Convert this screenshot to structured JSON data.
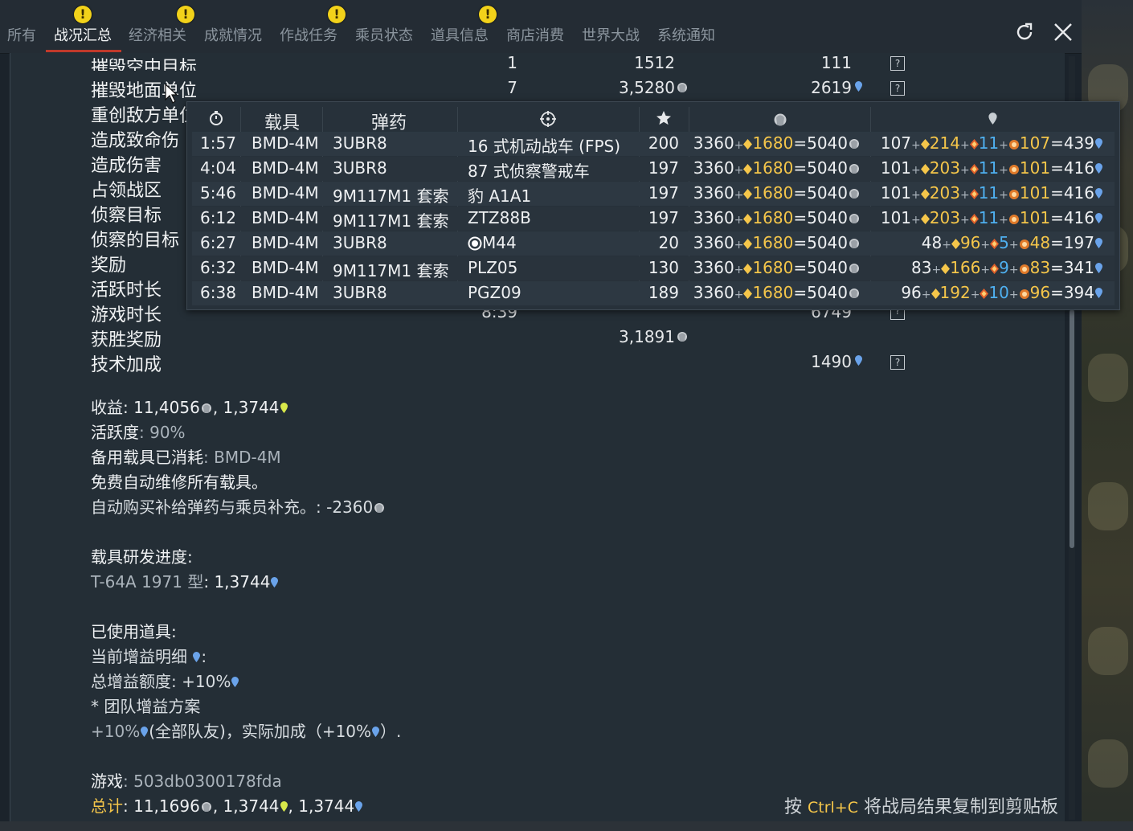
{
  "tabs": [
    {
      "label": "所有",
      "warn": false
    },
    {
      "label": "战况汇总",
      "warn": true,
      "active": true
    },
    {
      "label": "经济相关",
      "warn": true
    },
    {
      "label": "成就情况",
      "warn": false
    },
    {
      "label": "作战任务",
      "warn": true
    },
    {
      "label": "乘员状态",
      "warn": false
    },
    {
      "label": "道具信息",
      "warn": true
    },
    {
      "label": "商店消费",
      "warn": false
    },
    {
      "label": "世界大战",
      "warn": false
    },
    {
      "label": "系统通知",
      "warn": false
    }
  ],
  "warn_glyph": "!",
  "stats": [
    {
      "label": "摧毁空中目标",
      "count": "1",
      "silver": "1512",
      "rp": "111",
      "help": "?"
    },
    {
      "label": "摧毁地面单位",
      "count": "7",
      "silver": "3,5280",
      "rp": "2619",
      "help": "?"
    },
    {
      "label": "重创敌方单位"
    },
    {
      "label": "造成致命伤"
    },
    {
      "label": "造成伤害"
    },
    {
      "label": "占领战区"
    },
    {
      "label": "侦察目标"
    },
    {
      "label": "侦察的目标"
    },
    {
      "label": "奖励"
    },
    {
      "label": "活跃时长"
    },
    {
      "label": "游戏时长",
      "count": "8:39",
      "rp": "6749",
      "help": "?"
    },
    {
      "label": "获胜奖励",
      "silver": "3,1891"
    },
    {
      "label": "技术加成",
      "rp": "1490",
      "help": "?"
    }
  ],
  "summary": {
    "earnings_label": "收益",
    "earnings_silver": "11,4056",
    "earnings_gold_rp": "1,3744",
    "activity_label": "活跃度",
    "activity_value": "90%",
    "backup_label": "备用载具已消耗",
    "backup_value": "BMD-4M",
    "free_repair": "免费自动维修所有载具。",
    "auto_buy": "自动购买补给弹药与乘员补充。",
    "auto_buy_value": ": -2360",
    "research_label": "载具研发进度",
    "research_vehicle": "T-64A 1971 型",
    "research_value": "1,3744",
    "items_label": "已使用道具",
    "boost_label": "当前增益明细",
    "total_boost_label": "总增益额度",
    "total_boost_value": "+10%",
    "team_boost": "* 团队增益方案",
    "team_boost_detail_a": "+10%",
    "team_boost_detail_b": "(全部队友)，实际加成（+10%",
    "team_boost_detail_c": "）.",
    "session_label": "游戏",
    "session_value": "503db0300178fda",
    "total_label": "总计",
    "total_silver": "11,1696",
    "total_rp1": "1,3744",
    "total_rp2": "1,3744"
  },
  "hint": {
    "prefix": "按 ",
    "key": "Ctrl+C",
    "suffix": " 将战局结果复制到剪贴板"
  },
  "tooltip": {
    "headers": {
      "vehicle": "载具",
      "ammo": "弹药"
    },
    "rows": [
      {
        "time": "1:57",
        "vehicle": "BMD-4M",
        "ammo": "3UBR8",
        "target": "16 式机动战车 (FPS)",
        "score": "200",
        "s_base": "3360",
        "s_bonus": "1680",
        "s_total": "5040",
        "r_base": "107",
        "r_a": "214",
        "r_b": "11",
        "r_c": "107",
        "r_total": "439",
        "target_icon": false
      },
      {
        "time": "4:04",
        "vehicle": "BMD-4M",
        "ammo": "3UBR8",
        "target": "87 式侦察警戒车",
        "score": "197",
        "s_base": "3360",
        "s_bonus": "1680",
        "s_total": "5040",
        "r_base": "101",
        "r_a": "203",
        "r_b": "11",
        "r_c": "101",
        "r_total": "416",
        "target_icon": false
      },
      {
        "time": "5:46",
        "vehicle": "BMD-4M",
        "ammo": "9M117M1 套索",
        "target": "豹 A1A1",
        "score": "197",
        "s_base": "3360",
        "s_bonus": "1680",
        "s_total": "5040",
        "r_base": "101",
        "r_a": "203",
        "r_b": "11",
        "r_c": "101",
        "r_total": "416",
        "target_icon": false
      },
      {
        "time": "6:12",
        "vehicle": "BMD-4M",
        "ammo": "9M117M1 套索",
        "target": "ZTZ88B",
        "score": "197",
        "s_base": "3360",
        "s_bonus": "1680",
        "s_total": "5040",
        "r_base": "101",
        "r_a": "203",
        "r_b": "11",
        "r_c": "101",
        "r_total": "416",
        "target_icon": false
      },
      {
        "time": "6:27",
        "vehicle": "BMD-4M",
        "ammo": "3UBR8",
        "target": "M44",
        "score": "20",
        "s_base": "3360",
        "s_bonus": "1680",
        "s_total": "5040",
        "r_base": "48",
        "r_a": "96",
        "r_b": "5",
        "r_c": "48",
        "r_total": "197",
        "target_icon": true
      },
      {
        "time": "6:32",
        "vehicle": "BMD-4M",
        "ammo": "9M117M1 套索",
        "target": "PLZ05",
        "score": "130",
        "s_base": "3360",
        "s_bonus": "1680",
        "s_total": "5040",
        "r_base": "83",
        "r_a": "166",
        "r_b": "9",
        "r_c": "83",
        "r_total": "341",
        "target_icon": false
      },
      {
        "time": "6:38",
        "vehicle": "BMD-4M",
        "ammo": "3UBR8",
        "target": "PGZ09",
        "score": "189",
        "s_base": "3360",
        "s_bonus": "1680",
        "s_total": "5040",
        "r_base": "96",
        "r_a": "192",
        "r_b": "10",
        "r_c": "96",
        "r_total": "394",
        "target_icon": false
      }
    ]
  },
  "colors": {
    "accent": "#c0392b",
    "gold": "#f5c64a",
    "blue": "#4fb0f0",
    "warn": "#f2d21a"
  }
}
